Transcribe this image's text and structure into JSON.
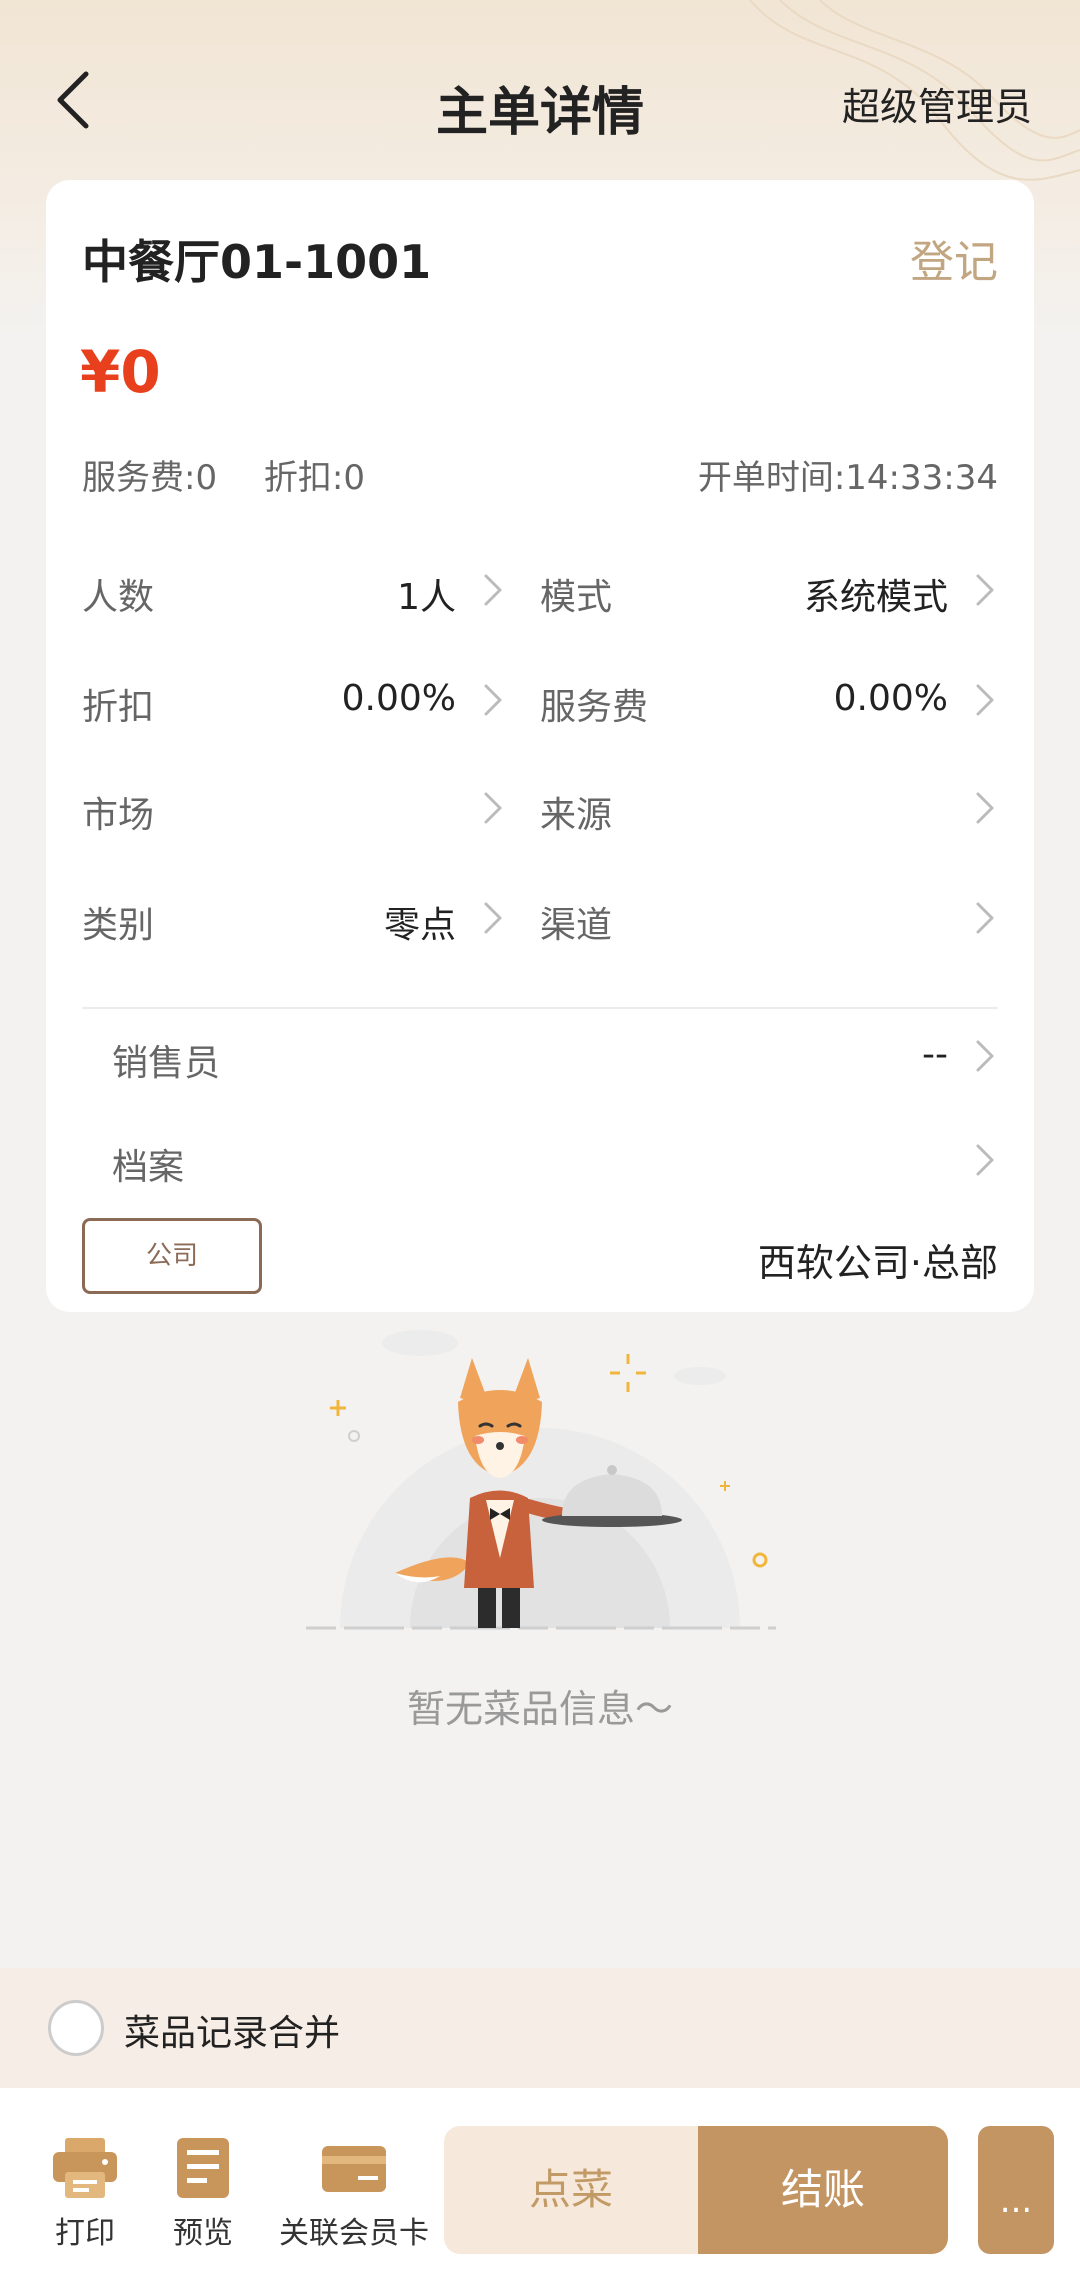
{
  "header": {
    "title": "主单详情",
    "user_role": "超级管理员"
  },
  "order": {
    "room": "中餐厅01-1001",
    "register_label": "登记",
    "amount": "¥0",
    "service_fee_text": "服务费:0",
    "discount_text": "折扣:0",
    "open_time_text": "开单时间:14:33:34"
  },
  "fields": {
    "people": {
      "label": "人数",
      "value": "1人"
    },
    "mode": {
      "label": "模式",
      "value": "系统模式"
    },
    "discount": {
      "label": "折扣",
      "value": "0.00%"
    },
    "service_fee": {
      "label": "服务费",
      "value": "0.00%"
    },
    "market": {
      "label": "市场",
      "value": ""
    },
    "source": {
      "label": "来源",
      "value": ""
    },
    "category": {
      "label": "类别",
      "value": "零点"
    },
    "channel": {
      "label": "渠道",
      "value": ""
    },
    "salesperson": {
      "label": "销售员",
      "value": "--"
    },
    "archive": {
      "label": "档案",
      "value": ""
    }
  },
  "company": {
    "tag": "公司",
    "name": "西软公司·总部"
  },
  "empty_state": {
    "text": "暂无菜品信息～"
  },
  "merge": {
    "label": "菜品记录合并",
    "checked": false
  },
  "toolbar": {
    "print_label": "打印",
    "preview_label": "预览",
    "member_card_label": "关联会员卡",
    "order_label": "点菜",
    "checkout_label": "结账",
    "more_label": "..."
  },
  "colors": {
    "accent": "#c39563",
    "accent_light": "#f6e9dc",
    "price": "#e8401c",
    "link": "#c2a682"
  },
  "icons": {
    "back": "chevron-left-icon",
    "row_arrow": "chevron-right-icon",
    "print": "printer-icon",
    "preview": "document-icon",
    "member_card": "card-icon"
  }
}
